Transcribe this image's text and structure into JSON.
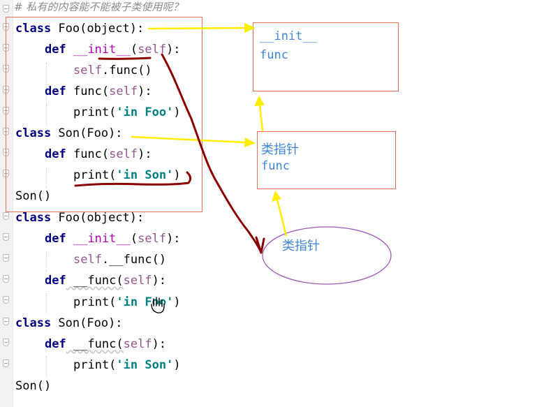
{
  "comment": "# 私有的内容能不能被子类使用呢？",
  "block1": {
    "l1": {
      "kw": "class",
      "name": " Foo(object):"
    },
    "l2": {
      "kw": "def",
      "sp": " ",
      "magic": "__init__",
      "open": "(",
      "self": "self",
      "close": "):"
    },
    "l3": {
      "self": "self",
      "rest": ".func()"
    },
    "l4": {
      "kw": "def",
      "name": " func(",
      "self": "self",
      "close": "):"
    },
    "l5": {
      "fn": "print(",
      "str": "'in Foo'",
      "close": ")"
    },
    "l6": {
      "kw": "class",
      "name": " Son(Foo):"
    },
    "l7": {
      "kw": "def",
      "name": " func(",
      "self": "self",
      "close": "):"
    },
    "l8": {
      "fn": "print(",
      "str": "'in Son'",
      "close": ")"
    },
    "l9": {
      "text": "Son()"
    }
  },
  "block2": {
    "l1": {
      "kw": "class",
      "name": " Foo(object):"
    },
    "l2": {
      "kw": "def",
      "sp": " ",
      "magic": "__init__",
      "open": "(",
      "self": "self",
      "close": "):"
    },
    "l3": {
      "self": "self",
      "rest": ".__func()"
    },
    "l4": {
      "kw": "def",
      "name": " __func(",
      "self": "self",
      "close": "):"
    },
    "l5": {
      "fn": "print(",
      "str": "'in Foo'",
      "close": ")"
    },
    "l6": {
      "kw": "class",
      "name": " Son(Foo):"
    },
    "l7": {
      "kw": "def",
      "name": " __func(",
      "self": "self",
      "close": "):"
    },
    "l8": {
      "fn": "print(",
      "str": "'in Son'",
      "close": ")"
    },
    "l9": {
      "text": "Son()"
    }
  },
  "annotations": {
    "foo_box": {
      "line1": "__init__",
      "line2": "func"
    },
    "son_box": {
      "line1": "类指针",
      "line2": "func"
    },
    "ellipse": {
      "label": "类指针"
    }
  },
  "colors": {
    "arrow_yellow": "#ffee00",
    "pen_red": "#8b0000",
    "box_border": "#e8705a",
    "ellipse": "#9b59b6",
    "annotation_text": "#3f86d6"
  },
  "cursor_icon": "hand-cursor-icon"
}
